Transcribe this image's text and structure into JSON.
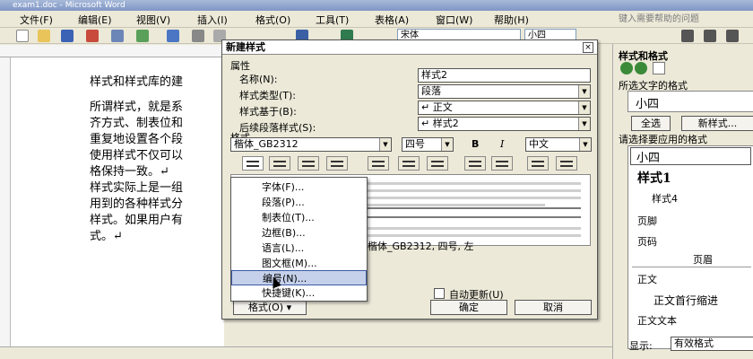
{
  "window": {
    "title": "exam1.doc - Microsoft Word"
  },
  "menu": {
    "items": [
      "文件(F)",
      "编辑(E)",
      "视图(V)",
      "插入(I)",
      "格式(O)",
      "工具(T)",
      "表格(A)",
      "窗口(W)",
      "帮助(H)"
    ],
    "help_placeholder": "键入需要帮助的问题"
  },
  "toolbar": {
    "font": "宋体",
    "size": "小四"
  },
  "document": {
    "lines": [
      "样式和样式库的建",
      "所谓样式，就是系",
      "齐方式、制表位和",
      "重复地设置各个段",
      "使用样式不仅可以",
      "格保持一致。↵",
      "样式实际上是一组",
      "用到的各种样式分",
      "样式。如果用户有",
      "式。↵"
    ]
  },
  "dialog": {
    "title": "新建样式",
    "properties_label": "属性",
    "name_label": "名称(N):",
    "name_value": "样式2",
    "type_label": "样式类型(T):",
    "type_value": "段落",
    "based_label": "样式基于(B):",
    "based_value": "↵ 正文",
    "next_label": "后续段落样式(S):",
    "next_value": "↵ 样式2",
    "format_label": "格式",
    "font_value": "楷体_GB2312",
    "size_value": "四号",
    "bold": "B",
    "italic": "I",
    "lang_value": "中文",
    "desc_text": "楷体_GB2312, 四号, 左",
    "auto_update": "自动更新(U)",
    "format_button": "格式(O) ▾",
    "ok": "确定",
    "cancel": "取消",
    "close": "×"
  },
  "popup": {
    "items": [
      "字体(F)...",
      "段落(P)...",
      "制表位(T)...",
      "边框(B)...",
      "语言(L)...",
      "图文框(M)...",
      "编号(N)...",
      "快捷键(K)..."
    ],
    "highlighted_index": 6
  },
  "panel": {
    "title": "样式和格式",
    "selected_label": "所选文字的格式",
    "selected_value": "小四",
    "select_all": "全选",
    "new_style": "新样式...",
    "apply_label": "请选择要应用的格式",
    "list": [
      "小四",
      "样式1",
      "样式4",
      "页脚",
      "页码",
      "页眉",
      "正文",
      "正文首行缩进",
      "正文文本"
    ],
    "show_label": "显示:",
    "show_value": "有效格式"
  }
}
